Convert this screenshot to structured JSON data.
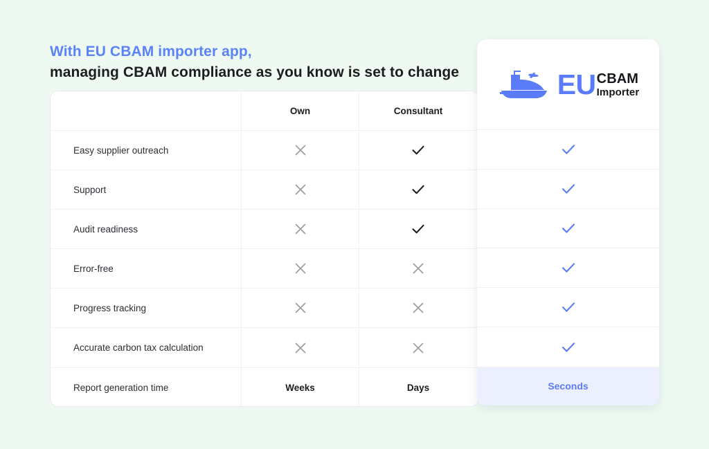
{
  "heading": {
    "line1": "With EU CBAM importer app,",
    "line2": "managing CBAM compliance as you know is set to change"
  },
  "colors": {
    "page_background": "#eefaf1",
    "accent_blue": "#5b7cf8",
    "heading_blue": "#5b83f7",
    "cross_gray": "#9a9da3",
    "check_black": "#1b1d21",
    "highlight_row_background": "#eceffd",
    "card_white": "#ffffff",
    "divider": "#eff1f3"
  },
  "logo": {
    "icon": "cargo-ship-icon",
    "plane_icon": "airplane-icon",
    "eu": "EU",
    "cbam": "CBAM",
    "importer": "Importer"
  },
  "table": {
    "columns": [
      {
        "key": "feature",
        "label": ""
      },
      {
        "key": "own",
        "label": "Own"
      },
      {
        "key": "consultant",
        "label": "Consultant"
      },
      {
        "key": "product",
        "label": ""
      }
    ],
    "rows": [
      {
        "feature": "Easy supplier outreach",
        "own": {
          "type": "cross-icon",
          "text": ""
        },
        "consultant": {
          "type": "check-icon",
          "text": ""
        },
        "product": {
          "type": "check-icon",
          "text": ""
        }
      },
      {
        "feature": "Support",
        "own": {
          "type": "cross-icon",
          "text": ""
        },
        "consultant": {
          "type": "check-icon",
          "text": ""
        },
        "product": {
          "type": "check-icon",
          "text": ""
        }
      },
      {
        "feature": "Audit readiness",
        "own": {
          "type": "cross-icon",
          "text": ""
        },
        "consultant": {
          "type": "check-icon",
          "text": ""
        },
        "product": {
          "type": "check-icon",
          "text": ""
        }
      },
      {
        "feature": "Error-free",
        "own": {
          "type": "cross-icon",
          "text": ""
        },
        "consultant": {
          "type": "cross-icon",
          "text": ""
        },
        "product": {
          "type": "check-icon",
          "text": ""
        }
      },
      {
        "feature": "Progress tracking",
        "own": {
          "type": "cross-icon",
          "text": ""
        },
        "consultant": {
          "type": "cross-icon",
          "text": ""
        },
        "product": {
          "type": "check-icon",
          "text": ""
        }
      },
      {
        "feature": "Accurate carbon tax calculation",
        "own": {
          "type": "cross-icon",
          "text": ""
        },
        "consultant": {
          "type": "cross-icon",
          "text": ""
        },
        "product": {
          "type": "check-icon",
          "text": ""
        }
      },
      {
        "feature": "Report generation time",
        "own": {
          "type": "text",
          "text": "Weeks"
        },
        "consultant": {
          "type": "text",
          "text": "Days"
        },
        "product": {
          "type": "text",
          "text": "Seconds"
        }
      }
    ]
  }
}
